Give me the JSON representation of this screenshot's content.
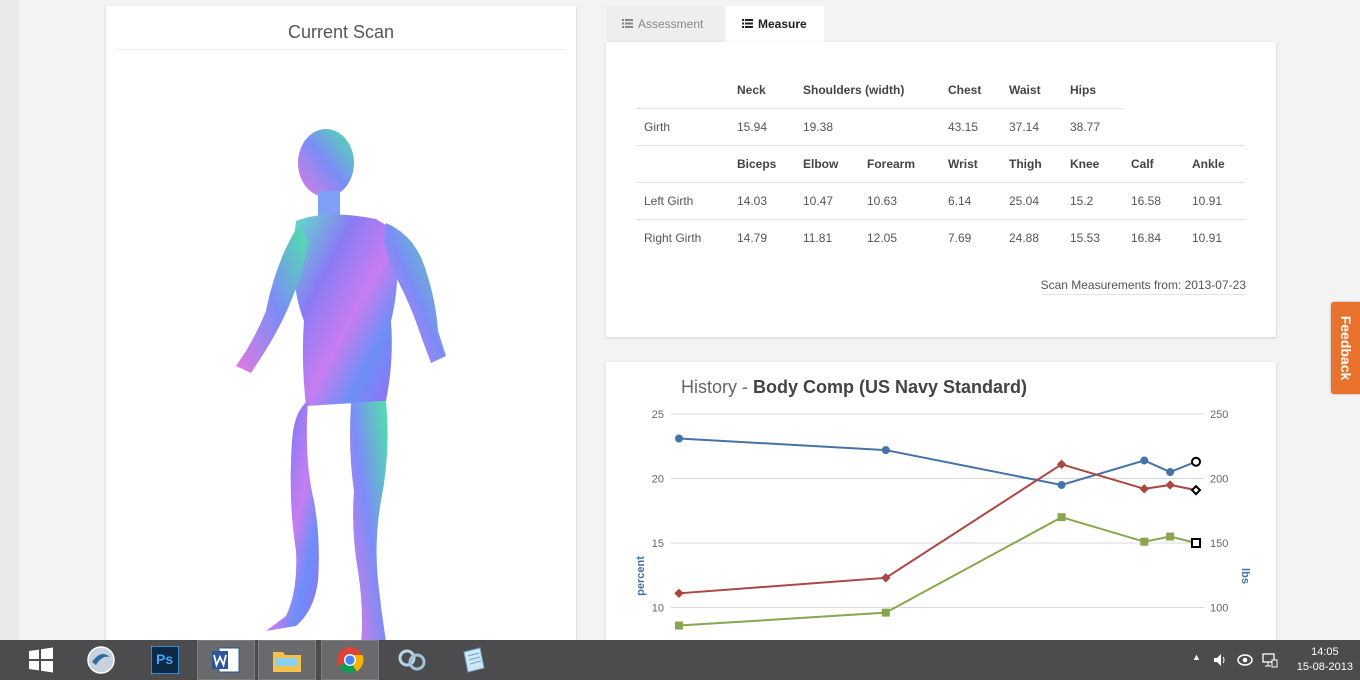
{
  "scan_panel": {
    "title": "Current Scan"
  },
  "tabs": [
    {
      "label": "Assessment",
      "active": false
    },
    {
      "label": "Measure",
      "active": true
    }
  ],
  "measure": {
    "upper_headers": [
      "Neck",
      "Shoulders (width)",
      "Chest",
      "Waist",
      "Hips"
    ],
    "girth": {
      "label": "Girth",
      "values": [
        "15.94",
        "19.38",
        "43.15",
        "37.14",
        "38.77"
      ]
    },
    "limb_headers": [
      "Biceps",
      "Elbow",
      "Forearm",
      "Wrist",
      "Thigh",
      "Knee",
      "Calf",
      "Ankle"
    ],
    "left": {
      "label": "Left Girth",
      "values": [
        "14.03",
        "10.47",
        "10.63",
        "6.14",
        "25.04",
        "15.2",
        "16.58",
        "10.91"
      ]
    },
    "right": {
      "label": "Right Girth",
      "values": [
        "14.79",
        "11.81",
        "12.05",
        "7.69",
        "24.88",
        "15.53",
        "16.84",
        "10.91"
      ]
    },
    "scan_date": "Scan Measurements from: 2013-07-23"
  },
  "history": {
    "title_prefix": "History - ",
    "title_main": "Body Comp (US Navy Standard)"
  },
  "chart_data": {
    "type": "line",
    "ylabel_left": "percent",
    "ylabel_right": "lbs",
    "left_ticks": [
      10,
      15,
      20,
      25
    ],
    "right_ticks": [
      100,
      150,
      200,
      250
    ],
    "ylim_left": [
      8,
      25
    ],
    "ylim_right": [
      80,
      250
    ],
    "x": [
      0,
      1,
      2,
      3,
      3.5,
      3.7,
      4
    ],
    "series": [
      {
        "axis": "right",
        "color": "#4572a7",
        "marker": "circle",
        "values": [
          231,
          222,
          195,
          214,
          205,
          213
        ],
        "x": [
          0,
          2,
          3.7,
          4.5,
          4.75,
          5
        ]
      },
      {
        "axis": "left",
        "color": "#aa4643",
        "marker": "diamond",
        "values": [
          11.1,
          12.3,
          21.1,
          19.2,
          19.5,
          19.1
        ],
        "x": [
          0,
          2,
          3.7,
          4.5,
          4.75,
          5
        ]
      },
      {
        "axis": "left",
        "color": "#89a54e",
        "marker": "square",
        "values": [
          8.6,
          9.6,
          17.0,
          15.1,
          15.5,
          15.0
        ],
        "x": [
          0,
          2,
          3.7,
          4.5,
          4.75,
          5
        ]
      }
    ]
  },
  "feedback": {
    "label": "Feedback"
  },
  "taskbar": {
    "time": "14:05",
    "date": "15-08-2013",
    "ps_label": "Ps"
  }
}
